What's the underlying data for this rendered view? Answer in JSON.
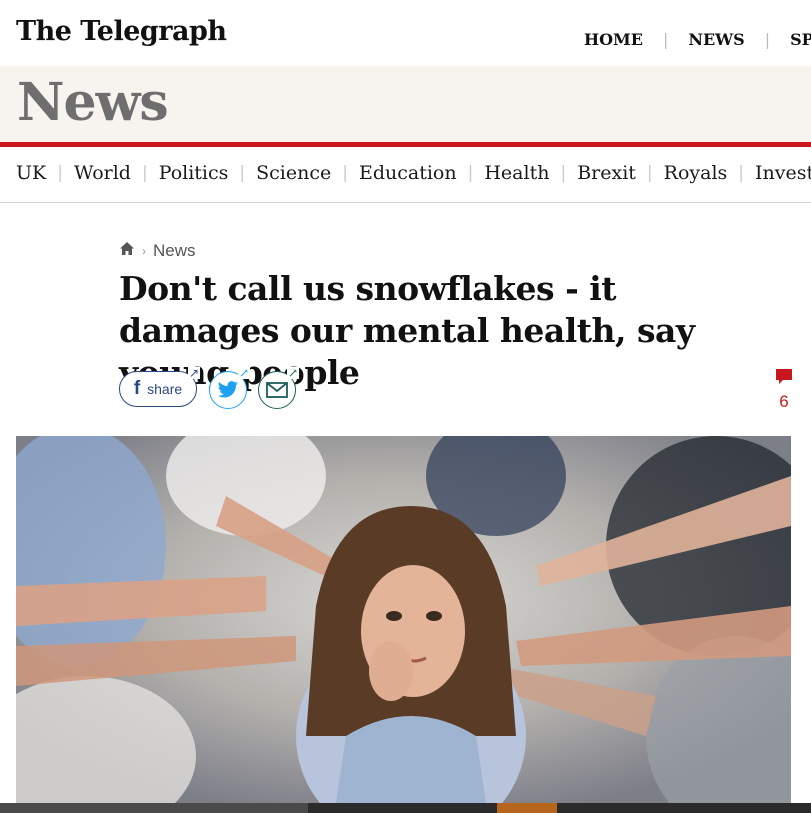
{
  "masthead": {
    "logo": "The Telegraph",
    "nav": [
      "HOME",
      "NEWS",
      "SPO"
    ]
  },
  "section": {
    "title": "News"
  },
  "subnav": {
    "items": [
      "UK",
      "World",
      "Politics",
      "Science",
      "Education",
      "Health",
      "Brexit",
      "Royals",
      "Investigat"
    ]
  },
  "breadcrumb": {
    "home_icon": "home-icon",
    "current": "News"
  },
  "article": {
    "headline": "Don't call us snowflakes - it damages our mental health, say young people"
  },
  "share": {
    "facebook_label": "share",
    "facebook_icon": "facebook-icon",
    "twitter_icon": "twitter-icon",
    "email_icon": "email-icon"
  },
  "comments": {
    "icon": "comment-icon",
    "count": "6"
  },
  "hero": {
    "icon": "photo",
    "colors": {
      "background": "#c7c5c2",
      "hair": "#5a3b25",
      "skin": "#e3b497",
      "shirt": "#9fb4d0"
    }
  },
  "colors": {
    "brand_red": "#c8171e",
    "section_band": "#f7f3ee",
    "section_title": "#6e6e6e",
    "facebook": "#2a4a7f",
    "twitter": "#1da1f2",
    "email": "#1b5c5c"
  }
}
